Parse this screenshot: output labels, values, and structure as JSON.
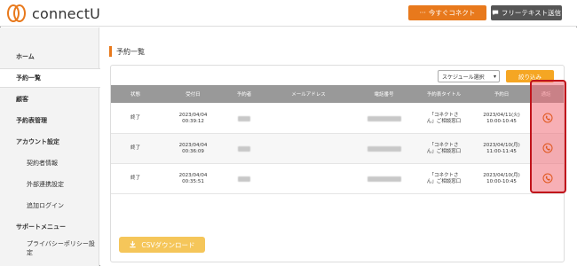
{
  "header": {
    "logo_text": "connectU",
    "connect_btn": "今すぐコネクト",
    "connect_dots": "···",
    "free_btn": "フリーテキスト送信"
  },
  "sidebar": {
    "items": [
      {
        "label": "ホーム"
      },
      {
        "label": "予約一覧"
      },
      {
        "label": "顧客"
      },
      {
        "label": "予約表管理"
      },
      {
        "label": "アカウント設定"
      },
      {
        "label": "契約者情報"
      },
      {
        "label": "外部連携設定"
      },
      {
        "label": "追加ログイン"
      },
      {
        "label": "サポートメニュー"
      },
      {
        "label": "プライバシーポリシー設定"
      }
    ]
  },
  "main": {
    "title": "予約一覧",
    "schedule_select": "スケジュール選択",
    "filter_btn": "絞り込み",
    "csv_btn": "CSVダウンロード",
    "columns": [
      "状態",
      "受付日",
      "予約者",
      "メールアドレス",
      "電話番号",
      "予約表タイトル",
      "予約日",
      "通話"
    ],
    "rows": [
      {
        "status": "終了",
        "recv_date": "2023/04/04",
        "recv_time": "00:39:12",
        "title_l1": "「コネクトさ",
        "title_l2": "ん」ご相談窓口",
        "date": "2023/04/11(火)",
        "time": "10:00-10:45"
      },
      {
        "status": "終了",
        "recv_date": "2023/04/04",
        "recv_time": "00:36:09",
        "title_l1": "「コネクトさ",
        "title_l2": "ん」ご相談窓口",
        "date": "2023/04/10(月)",
        "time": "11:00-11:45"
      },
      {
        "status": "終了",
        "recv_date": "2023/04/04",
        "recv_time": "00:35:51",
        "title_l1": "「コネクトさ",
        "title_l2": "ん」ご相談窓口",
        "date": "2023/04/10(月)",
        "time": "10:00-10:45"
      }
    ]
  },
  "colors": {
    "accent": "#e8791c",
    "filter": "#f5a623",
    "csv": "#f5c65a",
    "highlight_border": "#c0131b",
    "phone_icon": "#e0561b"
  },
  "icons": [
    "phone-icon",
    "download-icon",
    "chevron-down-icon"
  ]
}
